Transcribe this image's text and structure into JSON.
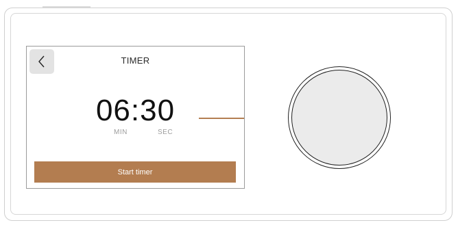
{
  "screen": {
    "title": "TIMER",
    "time": "06:30",
    "min_label": "MIN",
    "sec_label": "SEC",
    "start_button_label": "Start timer"
  },
  "colors": {
    "accent": "#b37d50",
    "knob_face": "#ebebeb",
    "back_button_bg": "#e3e3e3"
  },
  "icons": {
    "back": "chevron-left-icon"
  }
}
